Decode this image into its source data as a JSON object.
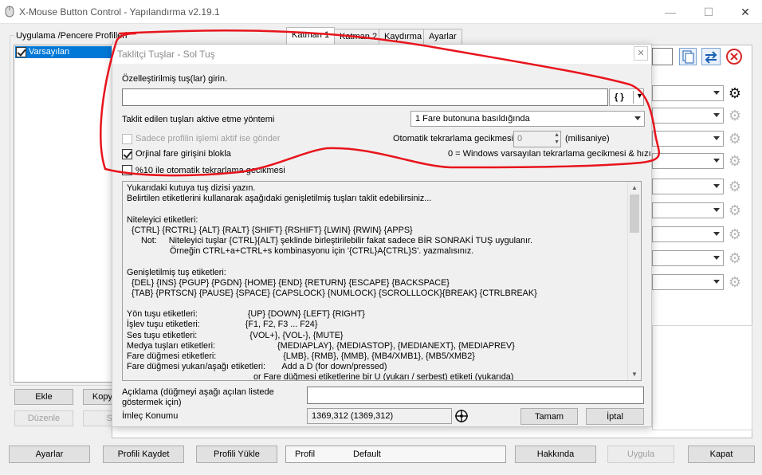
{
  "window": {
    "title": "X-Mouse Button Control - Yapılandırma v2.19.1",
    "minimize": "—",
    "maximize": "☐",
    "close": "✕"
  },
  "left_panel": {
    "group_label": "Uygulama /Pencere Profilleri",
    "profiles": [
      {
        "label": "Varsayılan",
        "checked": true
      }
    ],
    "add_button": "Ekle",
    "copy_button": "Kopy",
    "edit_button": "Düzenle",
    "delete_button": "S"
  },
  "tabs": [
    {
      "label": "Katman 1",
      "active": true
    },
    {
      "label": "Katman 2",
      "active": false
    },
    {
      "label": "Kaydırma",
      "active": false
    },
    {
      "label": "Ayarlar",
      "active": false
    }
  ],
  "bottom_bar": {
    "settings_button": "Ayarlar",
    "save_profile_button": "Profili Kaydet",
    "load_profile_button": "Profili Yükle",
    "profile_label": "Profil",
    "profile_value": "Default",
    "about_button": "Hakkında",
    "apply_button": "Uygula",
    "close_button": "Kapat"
  },
  "dialog": {
    "title": "Taklitçi Tuşlar - Sol Tuş",
    "close": "✕",
    "custom_keys_label": "Özelleştirilmiş tuş(lar) girin.",
    "custom_keys_value": "",
    "braces_button": "{ }",
    "method_label": "Taklit edilen tuşları aktive etme yöntemi",
    "method_value": "1 Fare butonuna basıldığında",
    "only_active_profile": "Sadece profilin işlemi aktif ise gönder",
    "block_original": "Orjinal fare girişini blokla",
    "random_delay": "%10 ile otomatik tekrarlama gecikmesi",
    "repeat_delay_label": "Otomatik tekrarlama gecikmesi",
    "repeat_delay_value": "0",
    "repeat_delay_unit": "(milisaniye)",
    "repeat_delay_note": "0 = Windows varsayılan tekrarlama gecikmesi & hızı",
    "help_lines": [
      "Yukarıdaki kutuya tuş dizisi yazın.",
      "Belirtilen etiketlerini kullanarak aşağıdaki genişletilmiş tuşları taklit edebilirsiniz...",
      "",
      "Niteleyici etiketleri:",
      "  {CTRL} {RCTRL} {ALT} {RALT} {SHIFT} {RSHIFT} {LWIN} {RWIN} {APPS}",
      "      Not:     Niteleyici tuşlar {CTRL}{ALT} şeklinde birleştirilebilir fakat sadece BİR SONRAKİ TUŞ uygulanır.",
      "                  Örneğin CTRL+a+CTRL+s kombinasyonu için '{CTRL}A{CTRL}S'. yazmalısınız.",
      "",
      "Genişletilmiş tuş etiketleri:",
      "  {DEL} {INS} {PGUP} {PGDN} {HOME} {END} {RETURN} {ESCAPE} {BACKSPACE}",
      "  {TAB} {PRTSCN} {PAUSE} {SPACE} {CAPSLOCK} {NUMLOCK} {SCROLLLOCK}{BREAK} {CTRLBREAK}",
      "",
      "Yön tuşu etiketleri:                     {UP} {DOWN} {LEFT} {RIGHT}",
      "İşlev tuşu etiketleri:                   {F1, F2, F3 ... F24}",
      "Ses tuşu etiketleri:                      {VOL+}, {VOL-}, {MUTE}",
      "Medya tuşları etiketleri:                          {MEDIAPLAY}, {MEDIASTOP}, {MEDIANEXT}, {MEDIAPREV}",
      "Fare düğmesi etiketleri:                            {LMB}, {RMB}, {MMB}, {MB4/XMB1}, {MB5/XMB2}",
      "Fare düğmesi yukarı/aşağı etiketleri:       Add a D (for down/pressed)",
      "                                                     or Fare düğmesi etiketlerine bir U (yukarı / serbest) etiketi (yukarıda)"
    ],
    "description_label_1": "Açıklama (düğmeyi aşağı açılan listede",
    "description_label_2": "göstermek için)",
    "description_value": "",
    "cursor_label": "İmleç Konumu",
    "cursor_value": "1369,312 (1369,312)",
    "ok_button": "Tamam",
    "cancel_button": "İptal"
  },
  "colors": {
    "annotation": "#e8141c",
    "selection": "#0078d7"
  }
}
